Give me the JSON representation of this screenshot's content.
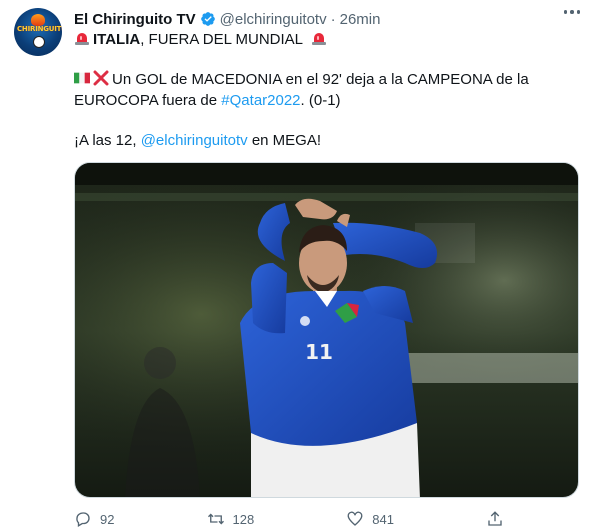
{
  "tweet": {
    "author_name": "El Chiringuito TV",
    "handle": "@elchiringuitotv",
    "separator": "·",
    "time": "26min",
    "avatar_text": "CHIRINGUITO",
    "line1": {
      "bold": "ITALIA",
      "rest": ", FUERA DEL MUNDIAL"
    },
    "line2": {
      "text": "Un GOL de MACEDONIA en el 92' deja a la CAMPEONA de la"
    },
    "line3": {
      "pre": "EUROCOPA fuera de ",
      "hashtag": "#Qatar2022",
      "post": ". (0-1)"
    },
    "line4": {
      "pre": "¡A las 12, ",
      "mention": "@elchiringuitotv",
      "post": " en MEGA!"
    },
    "actions": {
      "reply_count": "92",
      "retweet_count": "128",
      "like_count": "841",
      "share_label": ""
    },
    "media": {
      "shirt_number": "11"
    }
  },
  "icons": {
    "verified": "verified-badge-icon",
    "siren": "rotating-light-icon",
    "flag": "italy-flag-icon",
    "cross": "cross-mark-icon",
    "reply": "reply-icon",
    "retweet": "retweet-icon",
    "like": "heart-icon",
    "share": "share-icon",
    "more": "more-options-icon"
  },
  "colors": {
    "accent": "#1d9bf0",
    "secondary_text": "#536471",
    "jersey_blue": "#1f4fbf"
  }
}
